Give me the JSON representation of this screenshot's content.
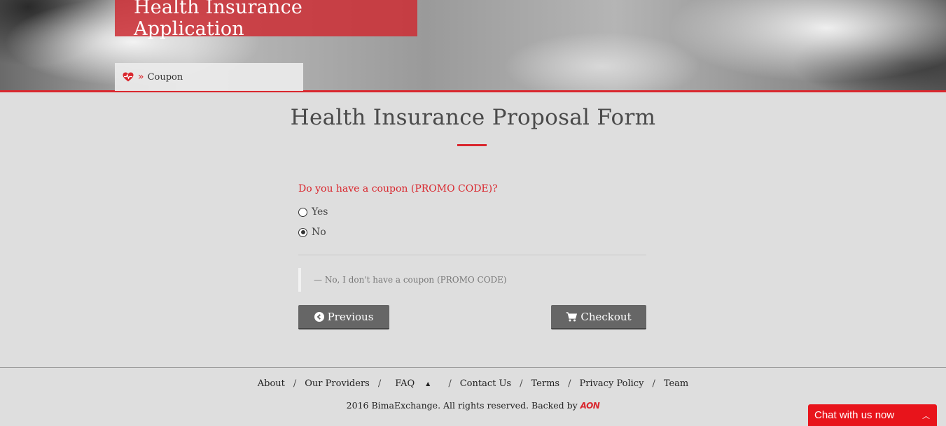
{
  "header": {
    "app_title": "Health Insurance Application",
    "breadcrumb": {
      "icon": "heart-pulse-icon",
      "separator_icon": "double-chevron-right-icon",
      "label": "Coupon"
    }
  },
  "main": {
    "heading": "Health Insurance Proposal Form",
    "question": "Do you have a coupon (PROMO CODE)?",
    "options": [
      {
        "label": "Yes",
        "selected": false
      },
      {
        "label": "No",
        "selected": true
      }
    ],
    "answer_summary": "— No, I don't have a coupon (PROMO CODE)",
    "buttons": {
      "previous": {
        "label": "Previous",
        "icon": "circle-chevron-left-icon"
      },
      "checkout": {
        "label": "Checkout",
        "icon": "shopping-cart-icon"
      }
    }
  },
  "footer": {
    "nav": [
      "About",
      "Our Providers",
      "FAQ",
      "Contact Us",
      "Terms",
      "Privacy Policy",
      "Team"
    ],
    "separator": "/",
    "copyright": "2016 BimaExchange. All rights reserved. Backed by",
    "backer_logo": "AON"
  },
  "chat": {
    "label": "Chat with us now",
    "icon": "chevron-up-icon"
  },
  "colors": {
    "accent": "#d9272e",
    "button": "#666666",
    "background": "#dedede",
    "chat": "#e8141b"
  }
}
